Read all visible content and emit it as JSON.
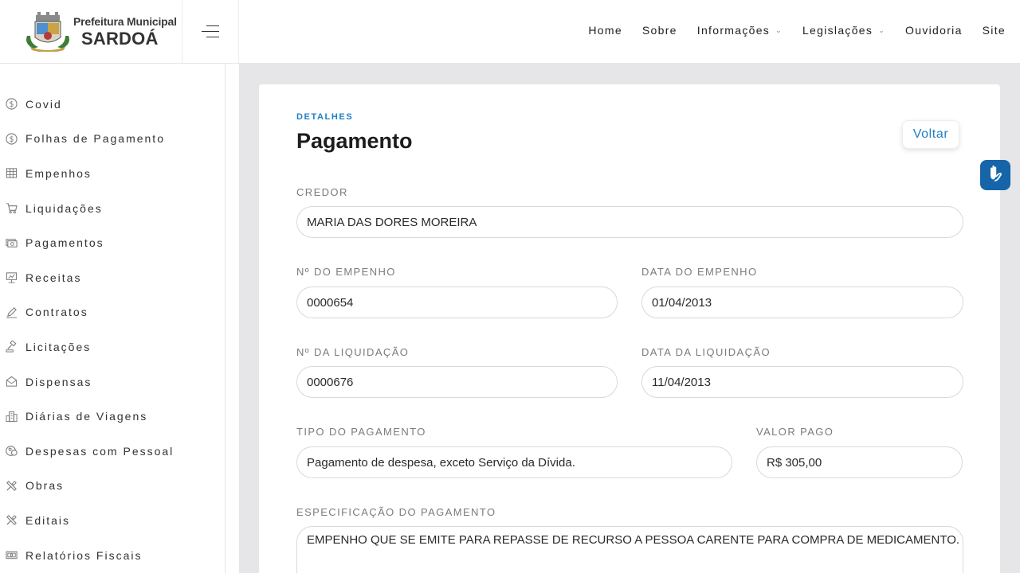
{
  "header": {
    "logo_line1": "Prefeitura Municipal",
    "logo_line2": "SARDOÁ",
    "nav": [
      {
        "label": "Home",
        "dropdown": false
      },
      {
        "label": "Sobre",
        "dropdown": false
      },
      {
        "label": "Informações",
        "dropdown": true
      },
      {
        "label": "Legislações",
        "dropdown": true
      },
      {
        "label": "Ouvidoria",
        "dropdown": false
      },
      {
        "label": "Site",
        "dropdown": false
      }
    ]
  },
  "sidebar": {
    "items": [
      {
        "label": "Covid",
        "icon": "dollar-circle-icon"
      },
      {
        "label": "Folhas de Pagamento",
        "icon": "dollar-circle-icon"
      },
      {
        "label": "Empenhos",
        "icon": "ledger-icon"
      },
      {
        "label": "Liquidações",
        "icon": "cart-icon"
      },
      {
        "label": "Pagamentos",
        "icon": "money-icon"
      },
      {
        "label": "Receitas",
        "icon": "presentation-icon"
      },
      {
        "label": "Contratos",
        "icon": "pen-icon"
      },
      {
        "label": "Licitações",
        "icon": "gavel-icon"
      },
      {
        "label": "Dispensas",
        "icon": "mail-open-icon"
      },
      {
        "label": "Diárias de Viagens",
        "icon": "building-icon"
      },
      {
        "label": "Despesas com Pessoal",
        "icon": "people-coin-icon"
      },
      {
        "label": "Obras",
        "icon": "tools-icon"
      },
      {
        "label": "Editais",
        "icon": "tools-icon"
      },
      {
        "label": "Relatórios Fiscais",
        "icon": "bill-icon"
      }
    ]
  },
  "main": {
    "kicker": "DETALHES",
    "title": "Pagamento",
    "back_label": "Voltar",
    "fields": {
      "credor": {
        "label": "CREDOR",
        "value": "MARIA DAS DORES MOREIRA"
      },
      "num_empenho": {
        "label": "Nº DO EMPENHO",
        "value": "0000654"
      },
      "data_empenho": {
        "label": "DATA DO EMPENHO",
        "value": "01/04/2013"
      },
      "num_liquidacao": {
        "label": "Nº DA LIQUIDAÇÃO",
        "value": "0000676"
      },
      "data_liquidacao": {
        "label": "DATA DA LIQUIDAÇÃO",
        "value": "11/04/2013"
      },
      "tipo_pagamento": {
        "label": "TIPO DO PAGAMENTO",
        "value": "Pagamento de despesa, exceto Serviço da Dívida."
      },
      "valor_pago": {
        "label": "VALOR PAGO",
        "value": "R$ 305,00"
      },
      "especificacao": {
        "label": "ESPECIFICAÇÃO DO PAGAMENTO",
        "value": "EMPENHO QUE SE EMITE PARA REPASSE DE RECURSO A PESSOA CARENTE PARA COMPRA DE MEDICAMENTO."
      }
    }
  },
  "colors": {
    "accent": "#1f7fc4",
    "vlibras": "#1565a8",
    "background": "#e6e6e9"
  }
}
